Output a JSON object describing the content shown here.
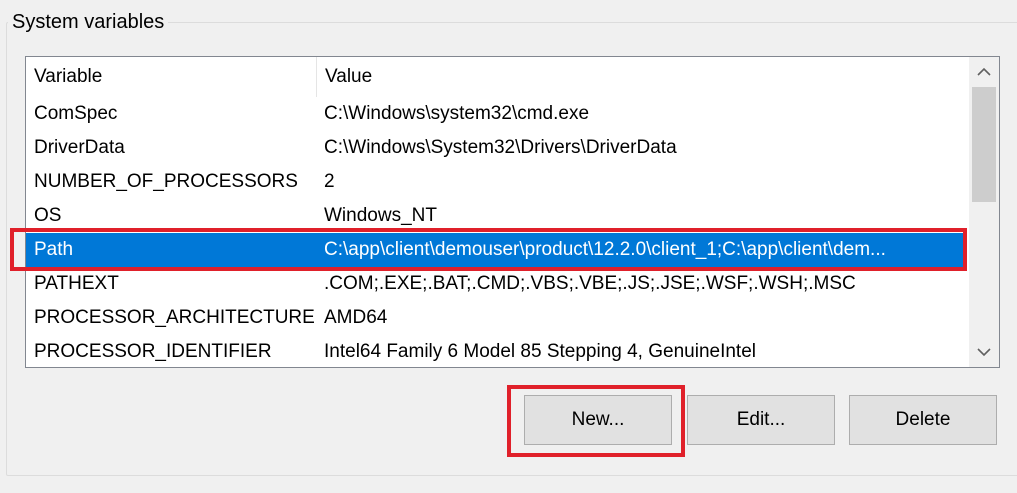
{
  "group": {
    "title": "System variables"
  },
  "list": {
    "columns": {
      "variable": "Variable",
      "value": "Value"
    },
    "rows": [
      {
        "variable": "ComSpec",
        "value": "C:\\Windows\\system32\\cmd.exe",
        "selected": false
      },
      {
        "variable": "DriverData",
        "value": "C:\\Windows\\System32\\Drivers\\DriverData",
        "selected": false
      },
      {
        "variable": "NUMBER_OF_PROCESSORS",
        "value": "2",
        "selected": false
      },
      {
        "variable": "OS",
        "value": "Windows_NT",
        "selected": false
      },
      {
        "variable": "Path",
        "value": "C:\\app\\client\\demouser\\product\\12.2.0\\client_1;C:\\app\\client\\dem...",
        "selected": true
      },
      {
        "variable": "PATHEXT",
        "value": ".COM;.EXE;.BAT;.CMD;.VBS;.VBE;.JS;.JSE;.WSF;.WSH;.MSC",
        "selected": false
      },
      {
        "variable": "PROCESSOR_ARCHITECTURE",
        "value": "AMD64",
        "selected": false
      },
      {
        "variable": "PROCESSOR_IDENTIFIER",
        "value": "Intel64 Family 6 Model 85 Stepping 4, GenuineIntel",
        "selected": false
      }
    ],
    "scroll_up_icon": "chevron-up-icon",
    "scroll_down_icon": "chevron-down-icon"
  },
  "buttons": {
    "new_label": "New...",
    "edit_label": "Edit...",
    "delete_label": "Delete"
  },
  "colors": {
    "selection": "#0078d7",
    "highlight": "#e0202a"
  }
}
